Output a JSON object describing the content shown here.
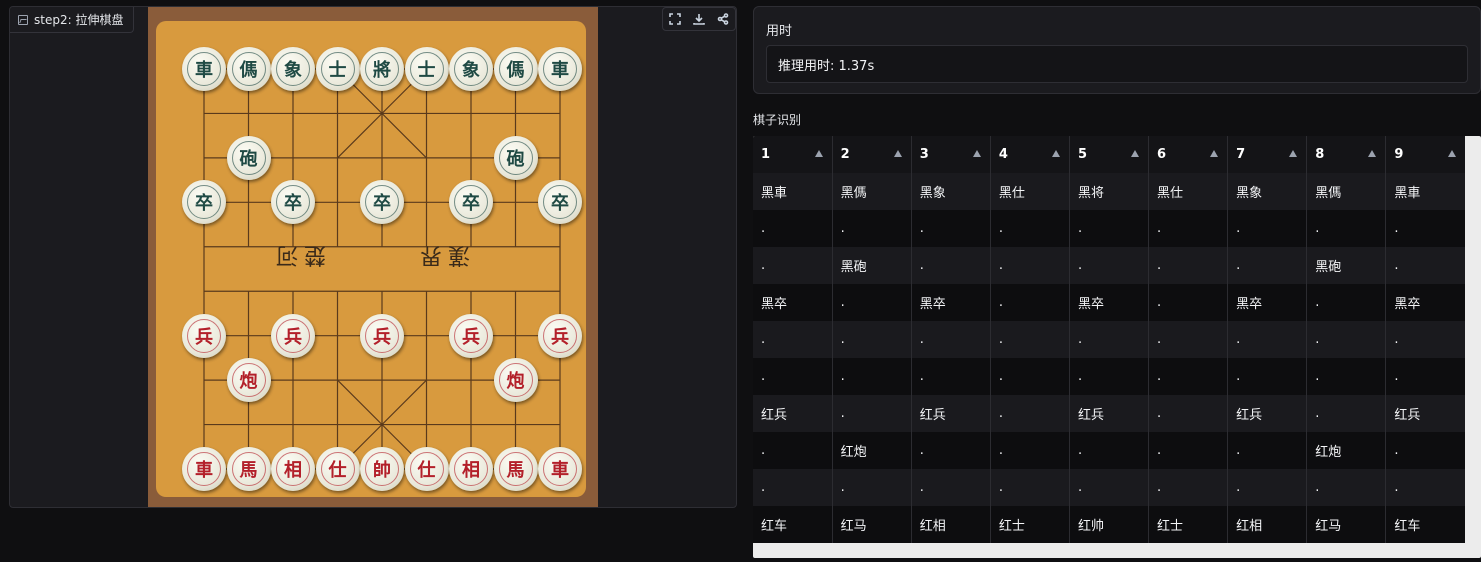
{
  "image_panel": {
    "label": "step2: 拉伸棋盘",
    "tools": [
      "fullscreen-icon",
      "download-icon",
      "share-icon"
    ]
  },
  "board_photo": {
    "river_left": "楚河",
    "river_right": "漢界",
    "pieces": [
      {
        "glyph": "車",
        "side": "black"
      },
      {
        "glyph": "傌",
        "side": "black"
      },
      {
        "glyph": "象",
        "side": "black"
      },
      {
        "glyph": "士",
        "side": "black"
      },
      {
        "glyph": "將",
        "side": "black"
      },
      {
        "glyph": "士",
        "side": "black"
      },
      {
        "glyph": "象",
        "side": "black"
      },
      {
        "glyph": "傌",
        "side": "black"
      },
      {
        "glyph": "車",
        "side": "black"
      },
      {
        "glyph": "砲",
        "side": "black"
      },
      {
        "glyph": "砲",
        "side": "black"
      },
      {
        "glyph": "卒",
        "side": "black"
      },
      {
        "glyph": "卒",
        "side": "black"
      },
      {
        "glyph": "卒",
        "side": "black"
      },
      {
        "glyph": "卒",
        "side": "black"
      },
      {
        "glyph": "卒",
        "side": "black"
      },
      {
        "glyph": "兵",
        "side": "red"
      },
      {
        "glyph": "兵",
        "side": "red"
      },
      {
        "glyph": "兵",
        "side": "red"
      },
      {
        "glyph": "兵",
        "side": "red"
      },
      {
        "glyph": "兵",
        "side": "red"
      },
      {
        "glyph": "炮",
        "side": "red"
      },
      {
        "glyph": "炮",
        "side": "red"
      },
      {
        "glyph": "車",
        "side": "red"
      },
      {
        "glyph": "馬",
        "side": "red"
      },
      {
        "glyph": "相",
        "side": "red"
      },
      {
        "glyph": "仕",
        "side": "red"
      },
      {
        "glyph": "帥",
        "side": "red"
      },
      {
        "glyph": "仕",
        "side": "red"
      },
      {
        "glyph": "相",
        "side": "red"
      },
      {
        "glyph": "馬",
        "side": "red"
      },
      {
        "glyph": "車",
        "side": "red"
      }
    ]
  },
  "timing": {
    "title": "用时",
    "value": "推理用时: 1.37s"
  },
  "recognition": {
    "title": "棋子识别",
    "headers": [
      "1",
      "2",
      "3",
      "4",
      "5",
      "6",
      "7",
      "8",
      "9"
    ],
    "rows": [
      [
        "黑車",
        "黑傌",
        "黑象",
        "黑仕",
        "黑将",
        "黑仕",
        "黑象",
        "黑傌",
        "黑車"
      ],
      [
        ".",
        ".",
        ".",
        ".",
        ".",
        ".",
        ".",
        ".",
        "."
      ],
      [
        ".",
        "黑砲",
        ".",
        ".",
        ".",
        ".",
        ".",
        "黑砲",
        "."
      ],
      [
        "黑卒",
        ".",
        "黑卒",
        ".",
        "黑卒",
        ".",
        "黑卒",
        ".",
        "黑卒"
      ],
      [
        ".",
        ".",
        ".",
        ".",
        ".",
        ".",
        ".",
        ".",
        "."
      ],
      [
        ".",
        ".",
        ".",
        ".",
        ".",
        ".",
        ".",
        ".",
        "."
      ],
      [
        "红兵",
        ".",
        "红兵",
        ".",
        "红兵",
        ".",
        "红兵",
        ".",
        "红兵"
      ],
      [
        ".",
        "红炮",
        ".",
        ".",
        ".",
        ".",
        ".",
        "红炮",
        "."
      ],
      [
        ".",
        ".",
        ".",
        ".",
        ".",
        ".",
        ".",
        ".",
        "."
      ],
      [
        "红车",
        "红马",
        "红相",
        "红士",
        "红帅",
        "红士",
        "红相",
        "红马",
        "红车"
      ]
    ]
  }
}
